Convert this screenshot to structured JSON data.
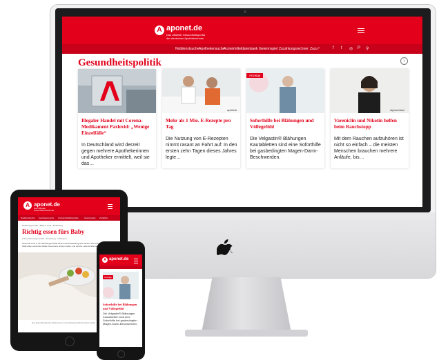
{
  "site": {
    "logo_name": "aponet.de",
    "logo_tagline": "Das offizielle Gesundheitsportal der deutschen Apothekerinnen und Apotheker",
    "brand_color": "#e2001a"
  },
  "imac": {
    "nav_items": [
      "Notdienstsuche",
      "Apothekensuche",
      "Arzneimitteldatenbank",
      "Gewinnspiel",
      "Zuzahlungsrechner",
      "Zuzu"
    ],
    "header_icons": [
      "facebook-icon",
      "twitter-icon",
      "instagram-icon",
      "pinterest-icon",
      "search-icon"
    ],
    "section_title": "Gesundheitspolitik",
    "cards": [
      {
        "title": "Illegaler Handel mit Corona-Medikament Paxlovid: „Wenige Einzelfälle“",
        "text": "In Deutschland wird derzeit gegen mehrere Apothekerinnen und Apotheker ermittelt, weil sie das…"
      },
      {
        "title": "Mehr als 1 Mio. E-Rezepte pro Tag",
        "text": "Die Nutzung von E-Rezepten nimmt rasant an Fahrt auf: In den ersten zehn Tagen dieses Jahres legte…",
        "credit": "apotheke"
      },
      {
        "badge": "Anzeige",
        "title": "Soforthilfe bei Blähungen und Völlegefühl",
        "text": "Die Velgastin® Blähungen Kautabletten sind eine Soforthilfe bei gasbedingten Magen-Darm-Beschwerden."
      },
      {
        "title": "Vareniclin und Nikotin helfen beim Rauchstopp",
        "text": "Mit dem Rauchen aufzuhören ist nicht so einfach – die meisten Menschen brauchen mehrere Anläufe, bis…",
        "credit": "wipharmideal"
      }
    ]
  },
  "ipad": {
    "nav_items": [
      "Notdienstsuche",
      "Apothekensuche",
      "Arzneimitteldatenbank",
      "Gewinnspiel",
      "Zuzahlun"
    ],
    "breadcrumb": "Ernährung & Diät › Baby & Kind › Ernährung",
    "title": "Richtig essen fürs Baby",
    "meta": "Fokus Schwangerschaft · Ernährung · 5 Minuten",
    "lead": "Gesunde Kost in der Schwangerschaft fördert die Entwicklung des Kindes. Auf welche Vitamine und Nährstoffe werdende Mütter besonders achten sollten und welche Lebensmittel tabu sind.",
    "caption": "Eine abwechslungsreiche Ernährung ist in der Schwangerschaft besonders wichtig."
  },
  "iphone": {
    "badge": "Anzeige",
    "title": "Soforthilfe bei Blähungen und Völlegefühl",
    "text": "Die Velgastin® Blähungen Kautabletten sind eine Soforthilfe bei gasbedingten Magen-Darm-Beschwerden."
  }
}
